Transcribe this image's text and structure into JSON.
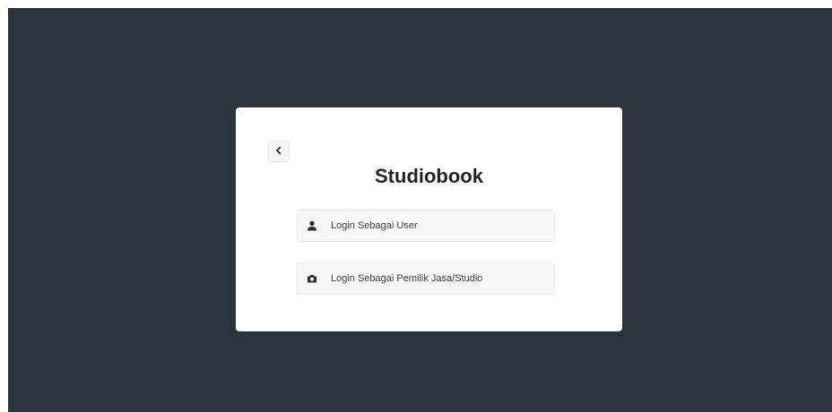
{
  "app": {
    "title": "Studiobook"
  },
  "back_button": {
    "icon": "chevron-left-icon"
  },
  "options": [
    {
      "label": "Login Sebagai User",
      "icon": "user-icon"
    },
    {
      "label": "Login Sebagai Pemilik Jasa/Studio",
      "icon": "camera-icon"
    }
  ],
  "colors": {
    "backdrop": "#2a343c",
    "card": "#ffffff",
    "option_bg": "#f7f8f9",
    "text": "#1f2328"
  }
}
